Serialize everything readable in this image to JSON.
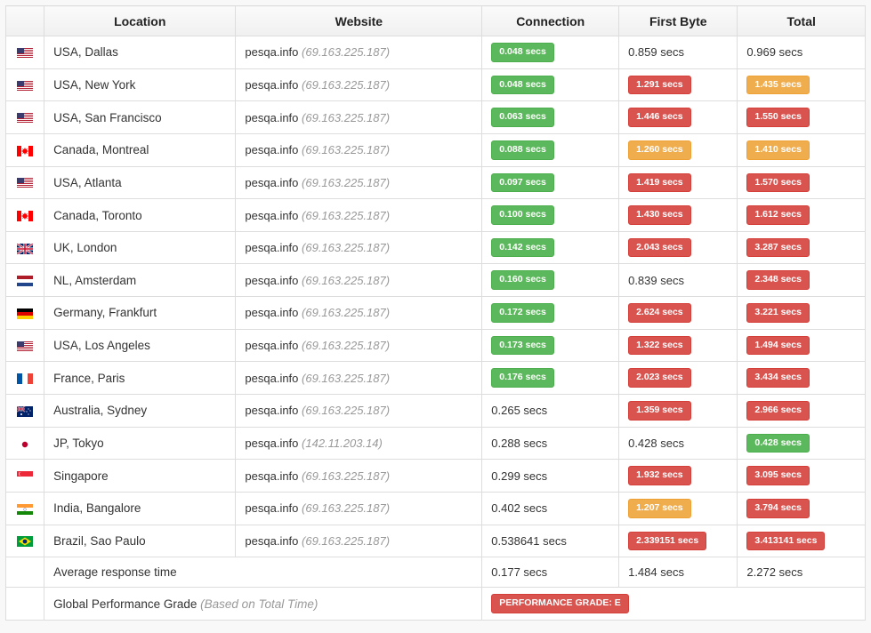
{
  "headers": {
    "location": "Location",
    "website": "Website",
    "connection": "Connection",
    "firstByte": "First Byte",
    "total": "Total"
  },
  "common": {
    "domain": "pesqa.info",
    "ip1": "(69.163.225.187)",
    "ip2": "(142.11.203.14)"
  },
  "rows": [
    {
      "flag": "us",
      "location": "USA, Dallas",
      "ipKey": "ip1",
      "conn": {
        "text": "0.048 secs",
        "style": "green"
      },
      "fb": {
        "text": "0.859 secs",
        "style": "plain"
      },
      "total": {
        "text": "0.969 secs",
        "style": "plain"
      }
    },
    {
      "flag": "us",
      "location": "USA, New York",
      "ipKey": "ip1",
      "conn": {
        "text": "0.048 secs",
        "style": "green"
      },
      "fb": {
        "text": "1.291 secs",
        "style": "red"
      },
      "total": {
        "text": "1.435 secs",
        "style": "yellow"
      }
    },
    {
      "flag": "us",
      "location": "USA, San Francisco",
      "ipKey": "ip1",
      "conn": {
        "text": "0.063 secs",
        "style": "green"
      },
      "fb": {
        "text": "1.446 secs",
        "style": "red"
      },
      "total": {
        "text": "1.550 secs",
        "style": "red"
      }
    },
    {
      "flag": "ca",
      "location": "Canada, Montreal",
      "ipKey": "ip1",
      "conn": {
        "text": "0.088 secs",
        "style": "green"
      },
      "fb": {
        "text": "1.260 secs",
        "style": "yellow"
      },
      "total": {
        "text": "1.410 secs",
        "style": "yellow"
      }
    },
    {
      "flag": "us",
      "location": "USA, Atlanta",
      "ipKey": "ip1",
      "conn": {
        "text": "0.097 secs",
        "style": "green"
      },
      "fb": {
        "text": "1.419 secs",
        "style": "red"
      },
      "total": {
        "text": "1.570 secs",
        "style": "red"
      }
    },
    {
      "flag": "ca",
      "location": "Canada, Toronto",
      "ipKey": "ip1",
      "conn": {
        "text": "0.100 secs",
        "style": "green"
      },
      "fb": {
        "text": "1.430 secs",
        "style": "red"
      },
      "total": {
        "text": "1.612 secs",
        "style": "red"
      }
    },
    {
      "flag": "uk",
      "location": "UK, London",
      "ipKey": "ip1",
      "conn": {
        "text": "0.142 secs",
        "style": "green"
      },
      "fb": {
        "text": "2.043 secs",
        "style": "red"
      },
      "total": {
        "text": "3.287 secs",
        "style": "red"
      }
    },
    {
      "flag": "nl",
      "location": "NL, Amsterdam",
      "ipKey": "ip1",
      "conn": {
        "text": "0.160 secs",
        "style": "green"
      },
      "fb": {
        "text": "0.839 secs",
        "style": "plain"
      },
      "total": {
        "text": "2.348 secs",
        "style": "red"
      }
    },
    {
      "flag": "de",
      "location": "Germany, Frankfurt",
      "ipKey": "ip1",
      "conn": {
        "text": "0.172 secs",
        "style": "green"
      },
      "fb": {
        "text": "2.624 secs",
        "style": "red"
      },
      "total": {
        "text": "3.221 secs",
        "style": "red"
      }
    },
    {
      "flag": "us",
      "location": "USA, Los Angeles",
      "ipKey": "ip1",
      "conn": {
        "text": "0.173 secs",
        "style": "green"
      },
      "fb": {
        "text": "1.322 secs",
        "style": "red"
      },
      "total": {
        "text": "1.494 secs",
        "style": "red"
      }
    },
    {
      "flag": "fr",
      "location": "France, Paris",
      "ipKey": "ip1",
      "conn": {
        "text": "0.176 secs",
        "style": "green"
      },
      "fb": {
        "text": "2.023 secs",
        "style": "red"
      },
      "total": {
        "text": "3.434 secs",
        "style": "red"
      }
    },
    {
      "flag": "au",
      "location": "Australia, Sydney",
      "ipKey": "ip1",
      "conn": {
        "text": "0.265 secs",
        "style": "plain"
      },
      "fb": {
        "text": "1.359 secs",
        "style": "red"
      },
      "total": {
        "text": "2.966 secs",
        "style": "red"
      }
    },
    {
      "flag": "jp",
      "location": "JP, Tokyo",
      "ipKey": "ip2",
      "conn": {
        "text": "0.288 secs",
        "style": "plain"
      },
      "fb": {
        "text": "0.428 secs",
        "style": "plain"
      },
      "total": {
        "text": "0.428 secs",
        "style": "green"
      }
    },
    {
      "flag": "sg",
      "location": "Singapore",
      "ipKey": "ip1",
      "conn": {
        "text": "0.299 secs",
        "style": "plain"
      },
      "fb": {
        "text": "1.932 secs",
        "style": "red"
      },
      "total": {
        "text": "3.095 secs",
        "style": "red"
      }
    },
    {
      "flag": "in",
      "location": "India, Bangalore",
      "ipKey": "ip1",
      "conn": {
        "text": "0.402 secs",
        "style": "plain"
      },
      "fb": {
        "text": "1.207 secs",
        "style": "yellow"
      },
      "total": {
        "text": "3.794 secs",
        "style": "red"
      }
    },
    {
      "flag": "br",
      "location": "Brazil, Sao Paulo",
      "ipKey": "ip1",
      "conn": {
        "text": "0.538641 secs",
        "style": "plain"
      },
      "fb": {
        "text": "2.339151 secs",
        "style": "red"
      },
      "total": {
        "text": "3.413141 secs",
        "style": "red"
      }
    }
  ],
  "summary": {
    "avgLabel": "Average response time",
    "avgConn": "0.177 secs",
    "avgFb": "1.484 secs",
    "avgTotal": "2.272 secs",
    "gradeLabel": "Global Performance Grade",
    "gradeNote": "(Based on Total Time)",
    "gradeBadge": "PERFORMANCE GRADE:  E"
  }
}
